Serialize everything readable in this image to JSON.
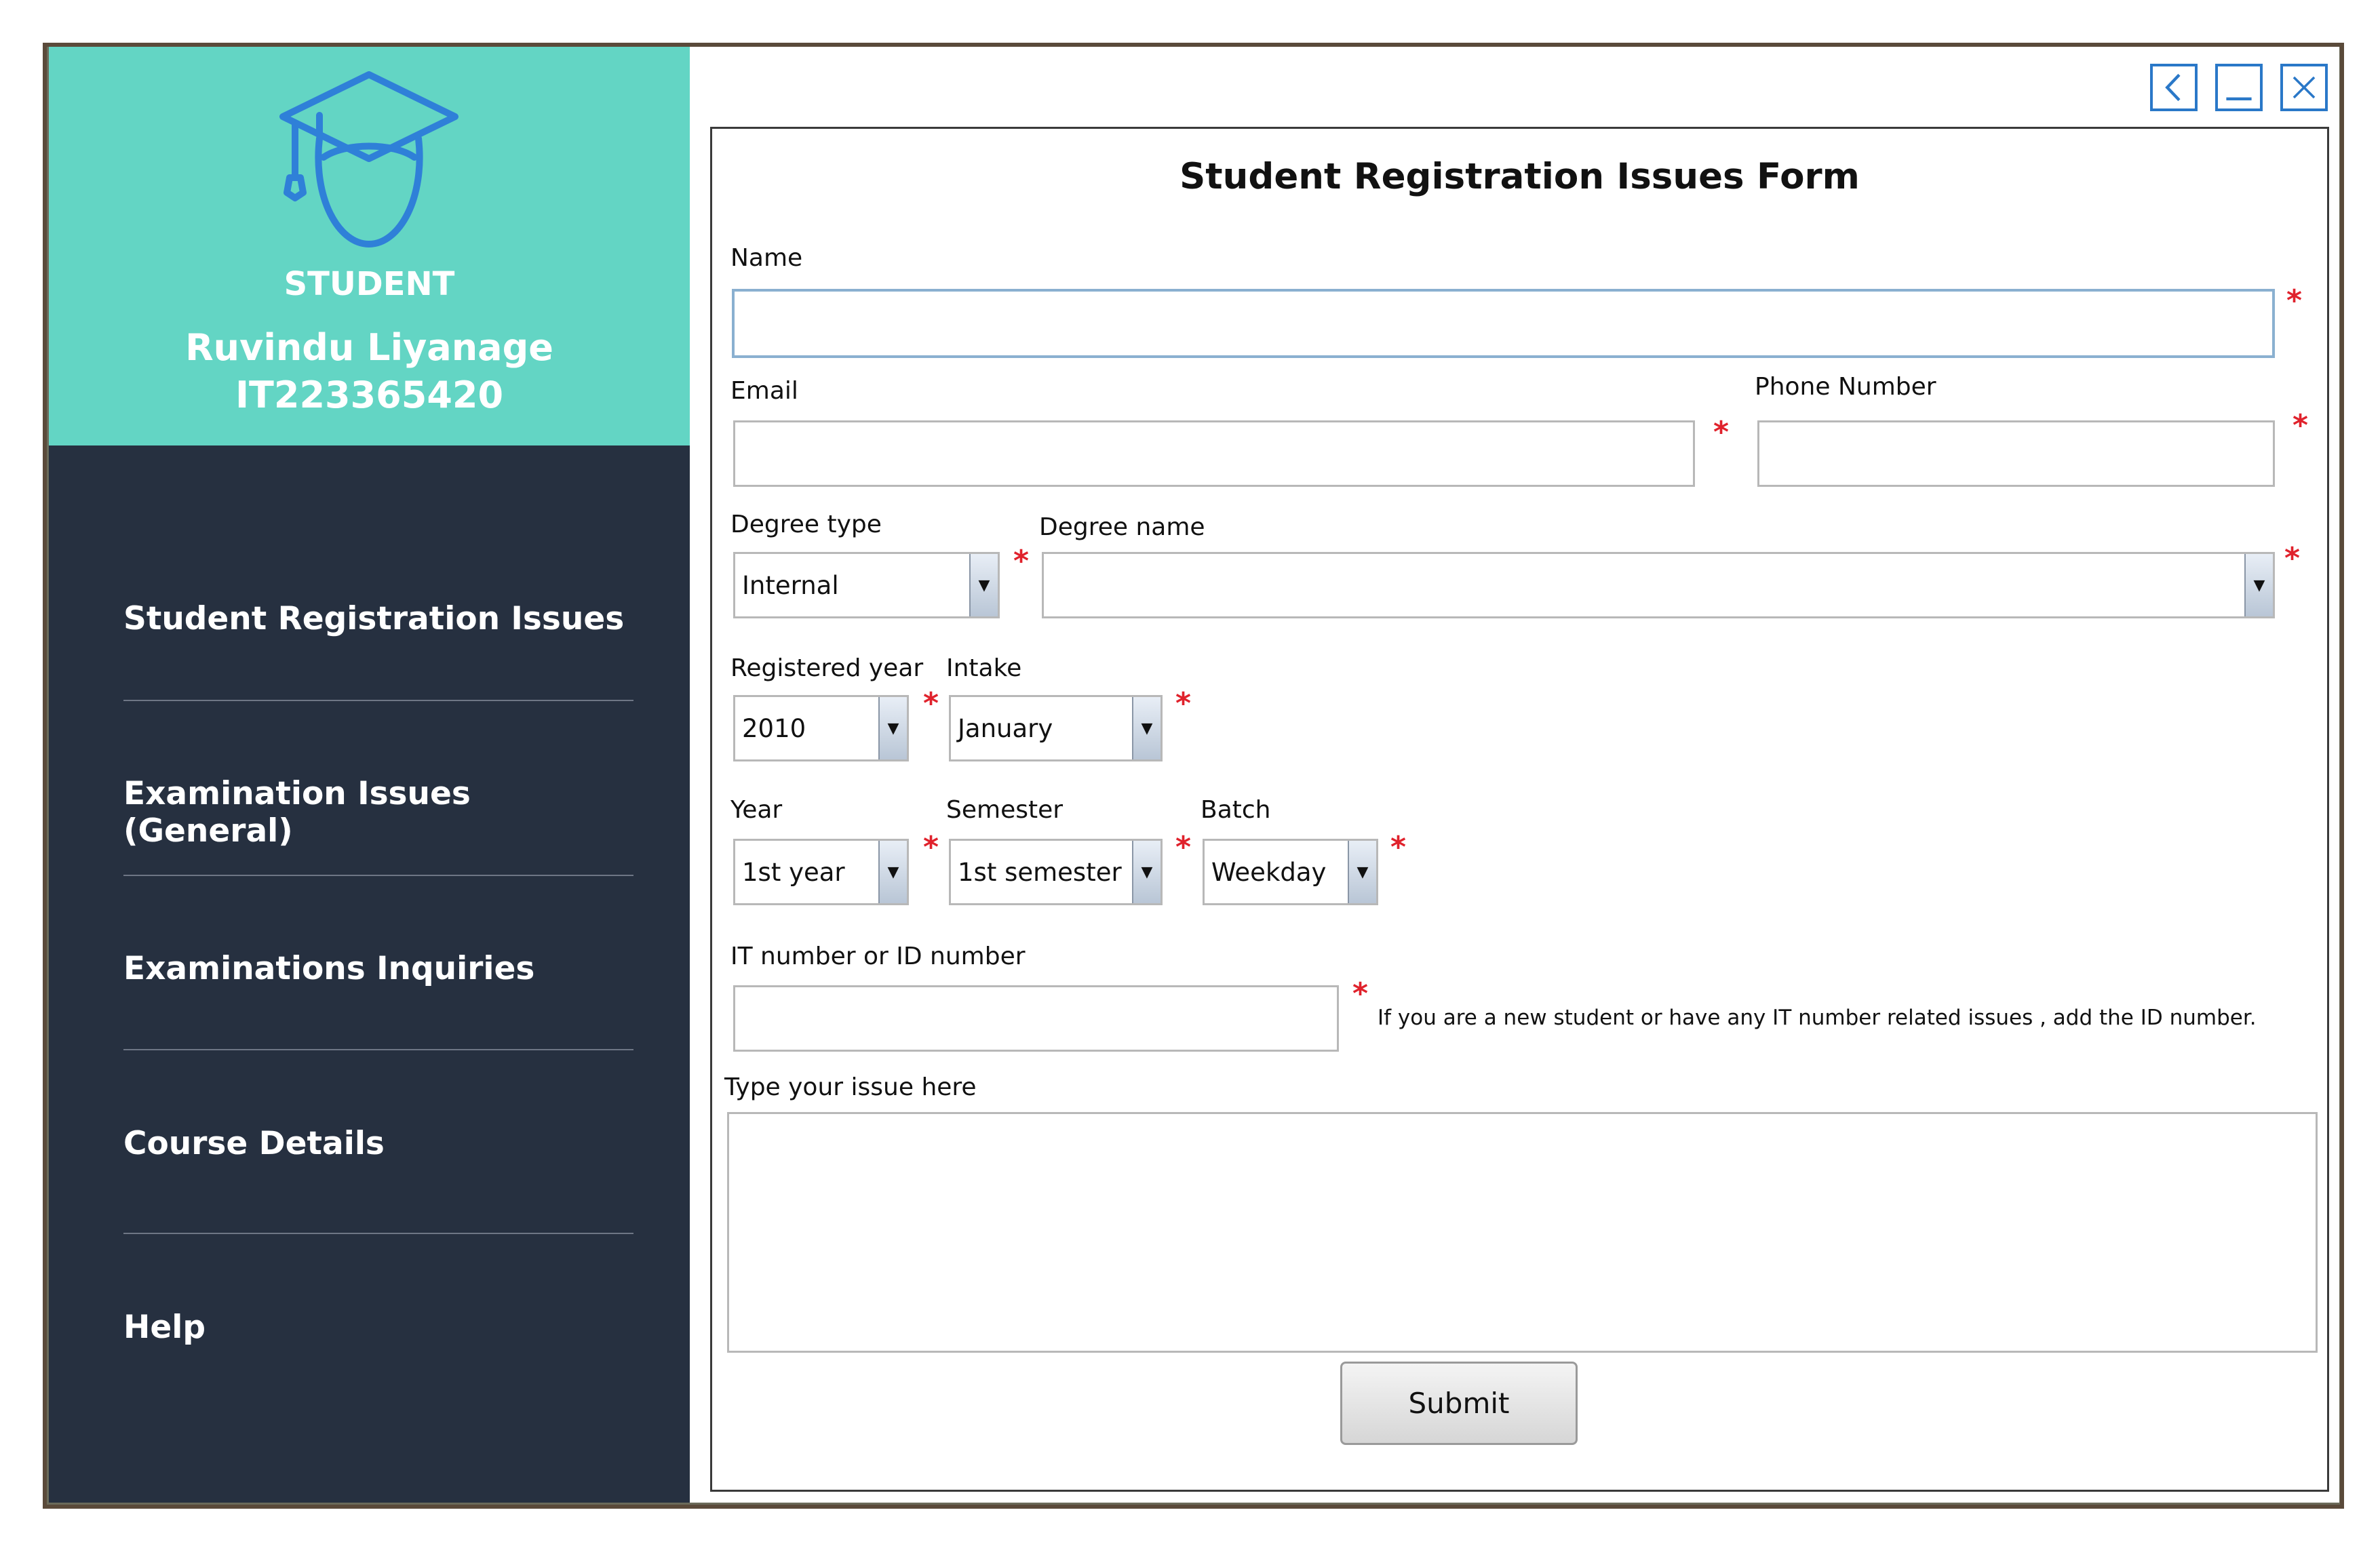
{
  "sidebar": {
    "profile": {
      "role": "STUDENT",
      "name": "Ruvindu Liyanage",
      "id": "IT223365420",
      "avatar_icon": "student-graduate-icon",
      "background_color": "#63d5c4"
    },
    "menu": [
      {
        "label": "Student Registration Issues"
      },
      {
        "label": "Examination Issues (General)"
      },
      {
        "label": "Examinations Inquiries"
      },
      {
        "label": "Course Details"
      },
      {
        "label": "Help"
      }
    ],
    "background_color": "#263040"
  },
  "window_controls": {
    "back_icon": "back-icon",
    "minimize_icon": "minimize-icon",
    "close_icon": "close-icon"
  },
  "form": {
    "title": "Student Registration Issues Form",
    "name": {
      "label": "Name",
      "value": ""
    },
    "email": {
      "label": "Email",
      "value": ""
    },
    "phone": {
      "label": "Phone Number",
      "value": ""
    },
    "degree_type": {
      "label": "Degree type",
      "selected": "Internal"
    },
    "degree_name": {
      "label": "Degree name",
      "selected": ""
    },
    "registered_year": {
      "label": "Registered year",
      "selected": "2010"
    },
    "intake": {
      "label": "Intake",
      "selected": "January"
    },
    "year": {
      "label": "Year",
      "selected": "1st year"
    },
    "semester": {
      "label": "Semester",
      "selected": "1st semester"
    },
    "batch": {
      "label": "Batch",
      "selected": "Weekday"
    },
    "it_number": {
      "label": "IT number or ID number",
      "value": "",
      "note": "If you are a new student or have any IT number related issues , add the ID number."
    },
    "issue": {
      "label": "Type your issue here",
      "value": ""
    },
    "required_mark": "*",
    "submit_label": "Submit"
  }
}
